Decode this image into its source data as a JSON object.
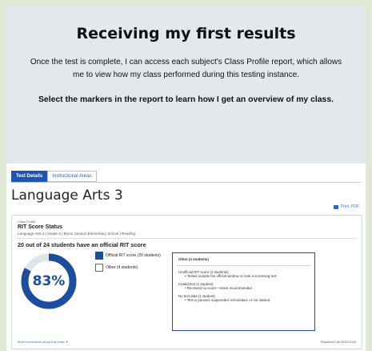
{
  "header": {
    "title": "Receiving my first results",
    "description": "Once the test is complete, I can access each subject's Class Profile report, which allows me to view how my class performed during this testing instance.",
    "cta": "Select the markers in the report to learn how I get an overview of my class."
  },
  "tabs": [
    {
      "label": "Test Details",
      "active": true
    },
    {
      "label": "Instructional Areas",
      "active": false
    }
  ],
  "report": {
    "subject": "Language Arts 3",
    "print_label": "Print .PDF",
    "crumb": "Class Profile",
    "panel_title": "RIT Score Status",
    "panel_subtitle": "Language Arts 3 | Grade 3 | Bryce Canyon Elementary School | Reading",
    "students_line": "20 out of 24 students have an official RIT score",
    "percent_label": "83%",
    "percent_value": 0.83,
    "legend": [
      {
        "label": "Official RIT score (20 students)",
        "color": "#1d4e9e"
      },
      {
        "label": "Other (4 students)",
        "color": "#ffffff"
      }
    ],
    "other_box": {
      "title": "Other (4 students)",
      "groups": [
        {
          "head": "Unofficial RIT score (2 students)",
          "bullet": "Tested outside the official window or took a screening test"
        },
        {
          "head": "Invalid test (1 student)",
          "bullet": "Received no score—retest recommended"
        },
        {
          "head": "No test data (1 student)",
          "bullet": "Test is paused, suspended, terminated, or not started"
        }
      ]
    },
    "more_link": "More information about this chart",
    "term": "Rostered Fall 2023-2024"
  },
  "colors": {
    "accent": "#1d4e9e",
    "background": "#dfe9d3",
    "card": "#e3e8ec"
  },
  "icons": {
    "print": "printer-icon",
    "more": "chevron-down-icon"
  }
}
